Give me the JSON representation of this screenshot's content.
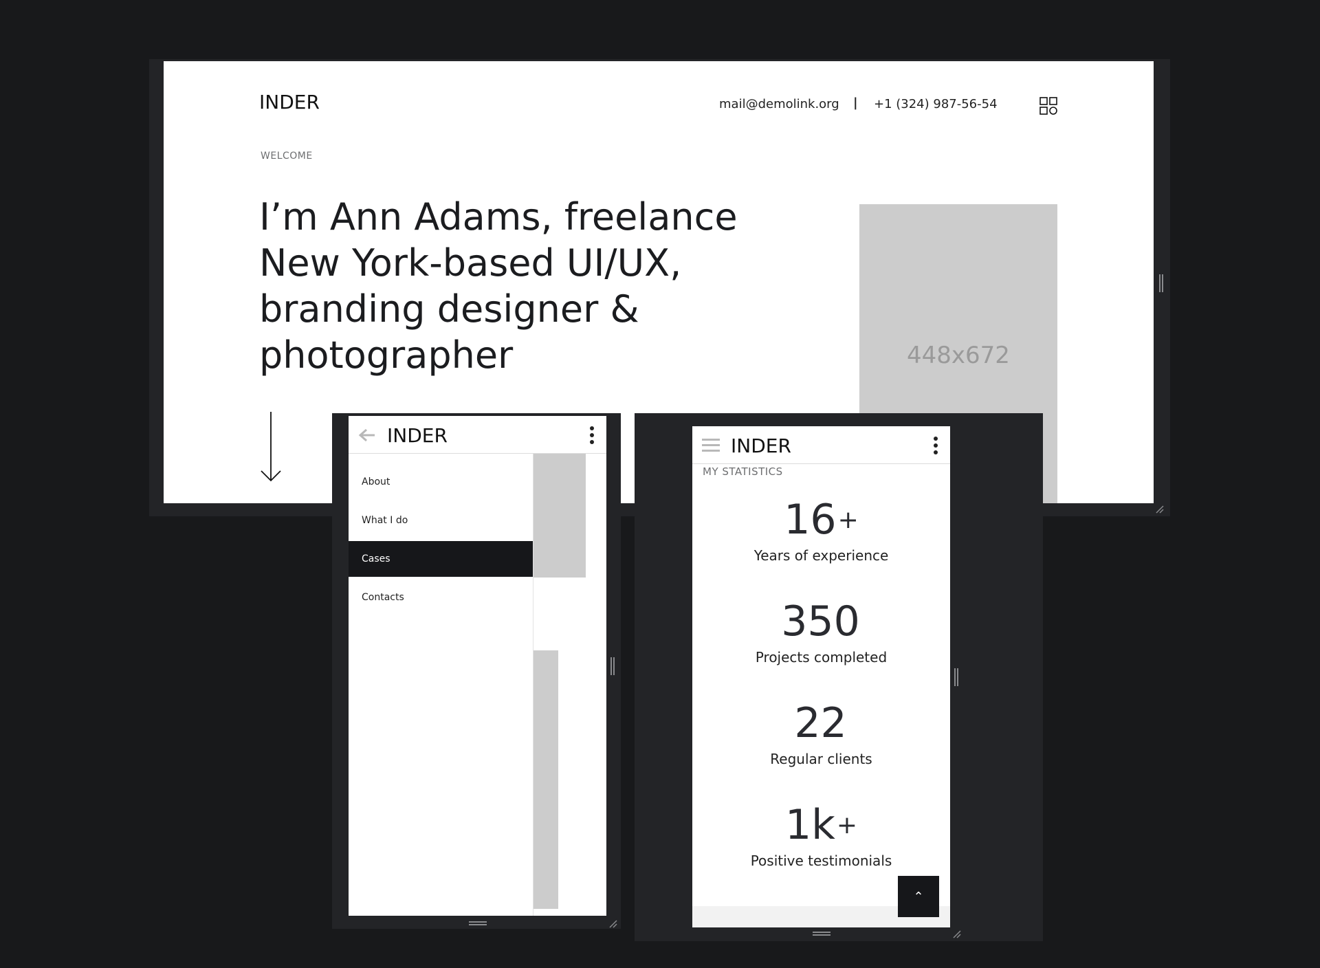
{
  "desktop": {
    "logo": "INDER",
    "email": "mail@demolink.org",
    "separator": "|",
    "phone": "+1 (324) 987-56-54",
    "menu_icon": "grid-icon",
    "eyebrow": "WELCOME",
    "headline": "I’m Ann Adams, freelance New York-based UI/UX, branding designer & photographer",
    "image_placeholder": "448x672",
    "scroll_icon": "arrow-down-icon"
  },
  "mobile_menu": {
    "back_icon": "arrow-left-icon",
    "logo": "INDER",
    "more_icon": "more-vertical-icon",
    "items": [
      {
        "label": "About",
        "active": false
      },
      {
        "label": "What I do",
        "active": false
      },
      {
        "label": "Cases",
        "active": true
      },
      {
        "label": "Contacts",
        "active": false
      }
    ]
  },
  "mobile_stats": {
    "menu_icon": "hamburger-icon",
    "logo": "INDER",
    "more_icon": "more-vertical-icon",
    "section_label": "MY STATISTICS",
    "stats": [
      {
        "value": "16",
        "suffix": "+",
        "label": "Years of experience"
      },
      {
        "value": "350",
        "suffix": "",
        "label": "Projects completed"
      },
      {
        "value": "22",
        "suffix": "",
        "label": "Regular clients"
      },
      {
        "value": "1k",
        "suffix": "+",
        "label": "Positive testimonials"
      }
    ],
    "scroll_top_label": "⌃",
    "scroll_top_icon": "chevron-up-icon"
  }
}
